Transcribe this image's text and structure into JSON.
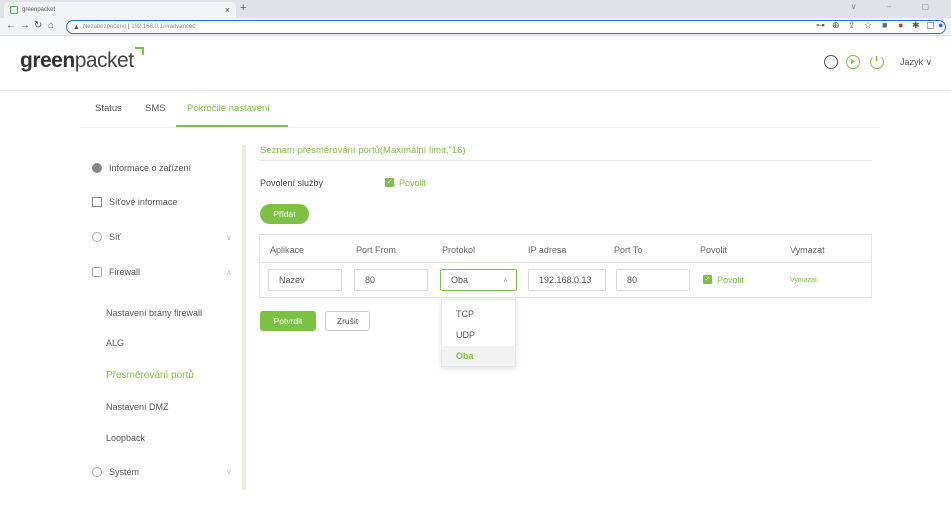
{
  "browser": {
    "tab_title": "greenpacket",
    "tab_close": "×",
    "new_tab": "+",
    "window_controls": "∨ – ▢",
    "security_label": "Nezabezpečeno",
    "url": "192.168.0.1/#/advanced"
  },
  "header": {
    "logo_text_a": "green",
    "logo_text_b": "packet",
    "language_label": "Jazyk",
    "language_chevron": "∨",
    "icons": [
      "refresh-icon",
      "play-icon",
      "power-icon"
    ]
  },
  "top_tabs": [
    {
      "label": "Status"
    },
    {
      "label": "SMS"
    },
    {
      "label": "Pokročilé nastavení",
      "active": true
    }
  ],
  "sidebar": {
    "items": [
      {
        "label": "Informace o zařízení",
        "icon": "info-icon"
      },
      {
        "label": "Síťové informace",
        "icon": "document-icon"
      },
      {
        "label": "Síť",
        "icon": "network-icon",
        "chevron": "∨"
      },
      {
        "label": "Firewall",
        "icon": "lock-icon",
        "chevron": "∧"
      },
      {
        "label": "Systém",
        "icon": "gear-icon",
        "chevron": "∨"
      }
    ],
    "firewall_sub": [
      {
        "label": "Nastavení brány firewall"
      },
      {
        "label": "ALG"
      },
      {
        "label": "Přesměrování portů",
        "active": true
      },
      {
        "label": "Nastavení DMZ"
      },
      {
        "label": "Loopback"
      }
    ]
  },
  "main": {
    "title": "Seznam přesměrování portů(Maximální limit,\"16)",
    "service_label": "Povolení služby",
    "service_checkbox_label": "Povolit",
    "add_button": "Přidat",
    "columns": [
      "Aplikace",
      "Port From",
      "Protokol",
      "IP adresa",
      "Port To",
      "Povolit",
      "Vymazat"
    ],
    "row": {
      "aplikace": "Nazev",
      "port_from": "80",
      "protokol": "Oba",
      "ip": "192.168.0.13",
      "port_to": "80",
      "povolit_label": "Povolit",
      "vymazat": "Vymazat"
    },
    "protocol_options": [
      "TCP",
      "UDP",
      "Oba"
    ],
    "protocol_selected": "Oba",
    "confirm_button": "Potvrdit",
    "cancel_button": "Zrušit"
  },
  "colors": {
    "accent": "#7cc242",
    "sidebar_border": "#e3f1d6"
  }
}
